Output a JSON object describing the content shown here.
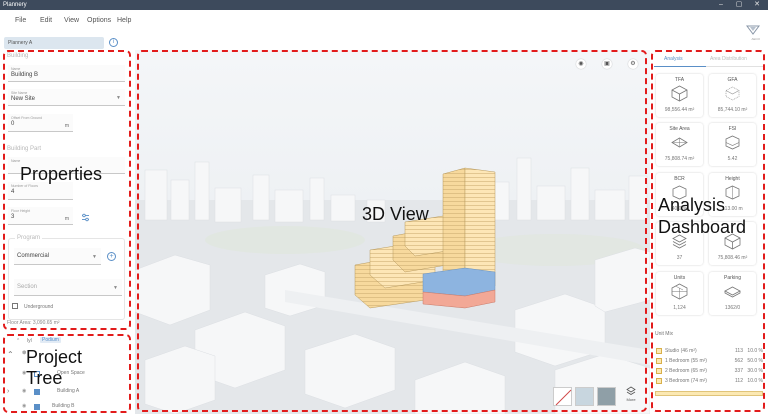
{
  "app": {
    "title": "Plannery",
    "logo_text": "AECO"
  },
  "window_controls": [
    "–",
    "▢",
    "✕"
  ],
  "menu": [
    "File",
    "Edit",
    "View",
    "Options",
    "Help"
  ],
  "tab": {
    "label": "Plannery A"
  },
  "properties": {
    "building_header": "Building",
    "name_label": "Name",
    "name_value": "Building B",
    "site_label": "Site Name",
    "site_value": "New Site",
    "offset_label": "Offset From Ground",
    "offset_value": "0",
    "offset_unit": "m",
    "part_header": "Building Part",
    "part_name_label": "Name",
    "floors_label": "Number of Floors",
    "floors_value": "4",
    "floor_height_label": "Floor Height",
    "floor_height_value": "3",
    "floor_height_unit": "m",
    "program_header": "Program",
    "program_value": "Commercial",
    "section_label": "Section",
    "underground_label": "Underground",
    "floor_area": "Floor Area: 3,090.65 m²"
  },
  "tree": {
    "top_label": "lyl",
    "items": [
      {
        "label": "Podium"
      },
      {
        "label": "Open Space"
      },
      {
        "label": "Building A"
      },
      {
        "label": "Building B"
      }
    ]
  },
  "viewport": {
    "more_label": "More"
  },
  "analysis": {
    "tabs": [
      "Analysis",
      "Area Distribution"
    ],
    "metrics": [
      {
        "label": "TFA",
        "value": "98,556.44 m²",
        "icon": "cube-icon"
      },
      {
        "label": "GFA",
        "value": "85,744.10 m²",
        "icon": "cube-outline-icon"
      },
      {
        "label": "Site Area",
        "value": "75,808.74 m²",
        "icon": "site-area-icon"
      },
      {
        "label": "FSI",
        "value": "5.42",
        "icon": "fsi-icon"
      },
      {
        "label": "BCR",
        "value": "40.0 %",
        "icon": "bcr-icon"
      },
      {
        "label": "Height",
        "value": "113.00 m",
        "icon": "height-icon"
      },
      {
        "label": "",
        "value": "37",
        "icon": "layers-icon"
      },
      {
        "label": "",
        "value": "75,808.46 m²",
        "icon": "cube-icon"
      },
      {
        "label": "Units",
        "value": "1,124",
        "icon": "units-icon"
      },
      {
        "label": "Parking",
        "value": "1362/0",
        "icon": "parking-icon"
      }
    ],
    "unit_mix_title": "Unit Mix",
    "unit_mix": [
      {
        "name": "Studio (46 m²)",
        "count": "113",
        "pct": "10.0 %"
      },
      {
        "name": "1 Bedroom (55 m²)",
        "count": "562",
        "pct": "50.0 %"
      },
      {
        "name": "2 Bedroom (65 m²)",
        "count": "337",
        "pct": "30.0 %"
      },
      {
        "name": "3 Bedroom (74 m²)",
        "count": "112",
        "pct": "10.0 %"
      }
    ]
  },
  "annotations": [
    {
      "label": "Properties"
    },
    {
      "label": "Project Tree"
    },
    {
      "label": "3D View"
    },
    {
      "label": "Analysis Dashboard"
    }
  ],
  "colors": {
    "accent": "#5a8fc7",
    "annotation": "#e21b1b",
    "tower": "#fde6b6",
    "podium_blue": "#8db4e0",
    "podium_red": "#f2a896"
  }
}
